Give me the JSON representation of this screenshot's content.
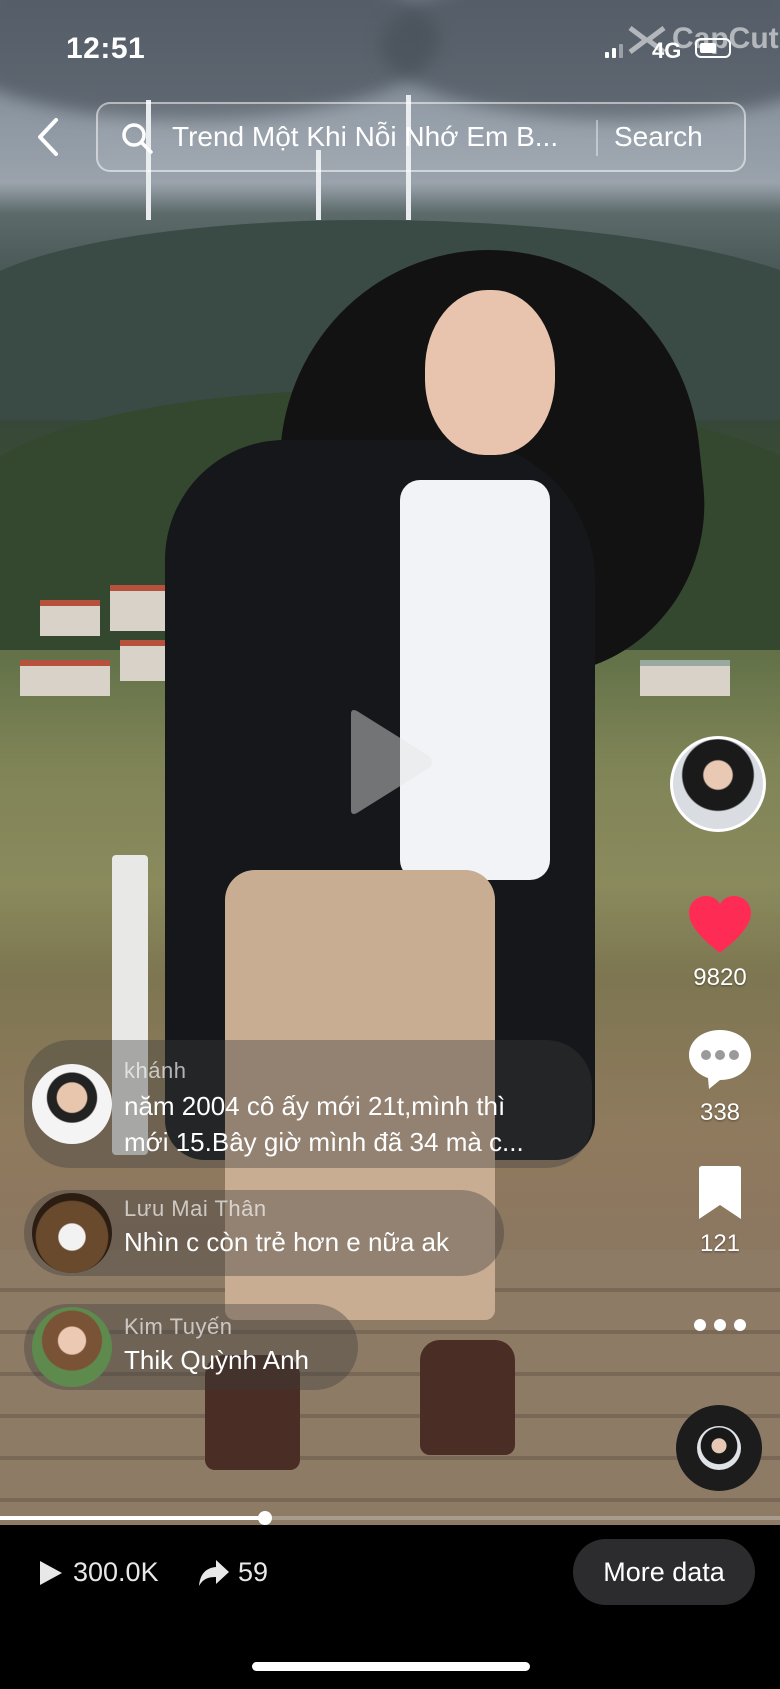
{
  "status_bar": {
    "time": "12:51",
    "network": "4G",
    "watermark": "CapCut"
  },
  "search": {
    "query": "Trend Một Khi Nỗi Nhớ Em B...",
    "button_label": "Search"
  },
  "rail": {
    "likes": "9820",
    "comments": "338",
    "saves": "121"
  },
  "comments": [
    {
      "author": "khánh",
      "line1": "năm 2004 cô ấy mới 21t,mình thì",
      "line2": "mới 15.Bây giờ mình đã 34 mà c..."
    },
    {
      "author": "Lưu  Mai  Thân",
      "line1": "Nhìn c còn trẻ hơn e nữa ak"
    },
    {
      "author": "Kim  Tuyến",
      "line1": "Thik Quỳnh Anh"
    }
  ],
  "playback": {
    "progress": 0.34
  },
  "bottom": {
    "plays": "300.0K",
    "shares": "59",
    "more_label": "More data"
  },
  "colors": {
    "like": "#fe2c55",
    "background": "#000000",
    "more_button": "#2c2c2e"
  },
  "icons": [
    "back-icon",
    "search-icon",
    "play-icon",
    "heart-icon",
    "comment-icon",
    "bookmark-icon",
    "more-icon",
    "share-icon",
    "play-count-icon"
  ]
}
